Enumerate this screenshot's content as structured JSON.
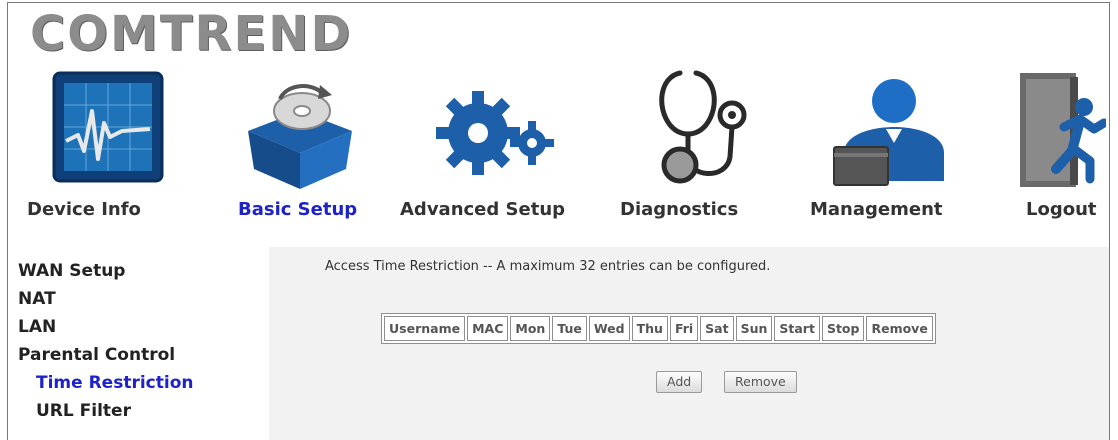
{
  "brand": {
    "logo_text": "COMTREND"
  },
  "nav": {
    "items": [
      {
        "label": "Device Info",
        "icon": "device-info-icon"
      },
      {
        "label": "Basic Setup",
        "icon": "basic-setup-icon",
        "active": true
      },
      {
        "label": "Advanced Setup",
        "icon": "advanced-setup-icon"
      },
      {
        "label": "Diagnostics",
        "icon": "diagnostics-icon"
      },
      {
        "label": "Management",
        "icon": "management-icon"
      },
      {
        "label": "Logout",
        "icon": "logout-icon"
      }
    ]
  },
  "sidebar": {
    "items": [
      {
        "label": "WAN Setup"
      },
      {
        "label": "NAT"
      },
      {
        "label": "LAN"
      },
      {
        "label": "Parental Control"
      },
      {
        "label": "Time Restriction",
        "active": true
      },
      {
        "label": "URL Filter"
      }
    ]
  },
  "main": {
    "title": "Access Time Restriction -- A maximum 32 entries can be configured.",
    "table": {
      "columns": [
        "Username",
        "MAC",
        "Mon",
        "Tue",
        "Wed",
        "Thu",
        "Fri",
        "Sat",
        "Sun",
        "Start",
        "Stop",
        "Remove"
      ],
      "rows": []
    },
    "buttons": {
      "add": "Add",
      "remove": "Remove"
    }
  },
  "colors": {
    "active_link": "#1d22c9",
    "logo_gray": "#8c8c8c",
    "icon_blue": "#1d5fa8",
    "content_bg": "#f2f2f2"
  }
}
